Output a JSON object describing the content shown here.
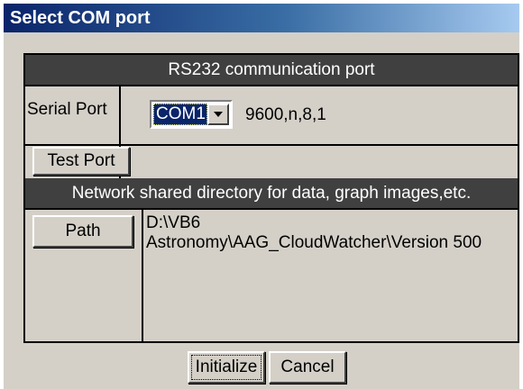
{
  "window": {
    "title": "Select COM  port"
  },
  "serial_section": {
    "header": "RS232 communication port",
    "port_label": "Serial Port",
    "port_value": "COM1",
    "port_settings": "9600,n,8,1",
    "test_button": "Test Port"
  },
  "network_section": {
    "header": "Network shared directory for data, graph images,etc.",
    "path_button": "Path",
    "path_value": "D:\\VB6 Astronomy\\AAG_CloudWatcher\\Version 500"
  },
  "footer": {
    "initialize_button": "Initialize",
    "cancel_button": "Cancel"
  },
  "icons": {
    "dropdown": "chevron-down-icon"
  }
}
